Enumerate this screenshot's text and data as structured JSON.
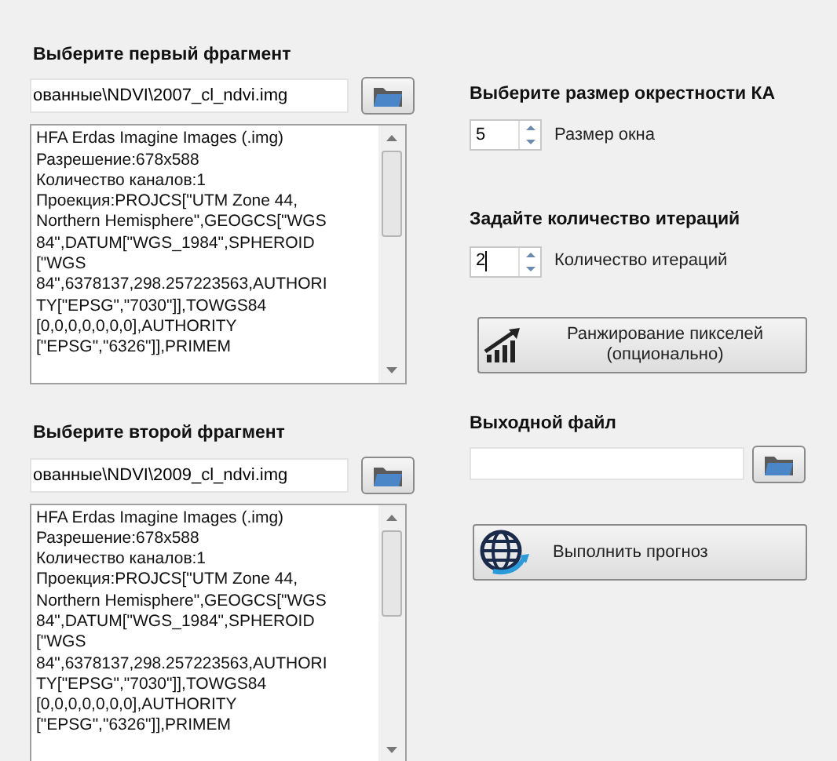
{
  "fragments": [
    {
      "title": "Выберите первый фрагмент",
      "path": "ованные\\NDVI\\2007_cl_ndvi.img",
      "info_lines": [
        "HFA Erdas Imagine Images (.img)",
        "Разрешение:678x588",
        "Количество каналов:1",
        "Проекция:PROJCS[\"UTM Zone 44,",
        "Northern Hemisphere\",GEOGCS[\"WGS",
        "84\",DATUM[\"WGS_1984\",SPHEROID",
        "[\"WGS",
        "84\",6378137,298.257223563,AUTHORI",
        "TY[\"EPSG\",\"7030\"]],TOWGS84",
        "[0,0,0,0,0,0,0],AUTHORITY",
        "[\"EPSG\",\"6326\"]],PRIMEM"
      ]
    },
    {
      "title": "Выберите второй фрагмент",
      "path": "ованные\\NDVI\\2009_cl_ndvi.img",
      "info_lines": [
        "HFA Erdas Imagine Images (.img)",
        "Разрешение:678x588",
        "Количество каналов:1",
        "Проекция:PROJCS[\"UTM Zone 44,",
        "Northern Hemisphere\",GEOGCS[\"WGS",
        "84\",DATUM[\"WGS_1984\",SPHEROID",
        "[\"WGS",
        "84\",6378137,298.257223563,AUTHORI",
        "TY[\"EPSG\",\"7030\"]],TOWGS84",
        "[0,0,0,0,0,0,0],AUTHORITY",
        "[\"EPSG\",\"6326\"]],PRIMEM"
      ]
    }
  ],
  "neighborhood": {
    "title": "Выберите размер окрестности КА",
    "value": "5",
    "label": "Размер окна",
    "focused": false
  },
  "iterations": {
    "title": "Задайте количество итераций",
    "value": "2",
    "label": "Количество итераций",
    "focused": true
  },
  "rank_button": {
    "lines": [
      "Ранжирование пикселей",
      "(опционально)"
    ]
  },
  "output": {
    "title": "Выходной файл"
  },
  "run_button": {
    "label": "Выполнить прогноз"
  }
}
